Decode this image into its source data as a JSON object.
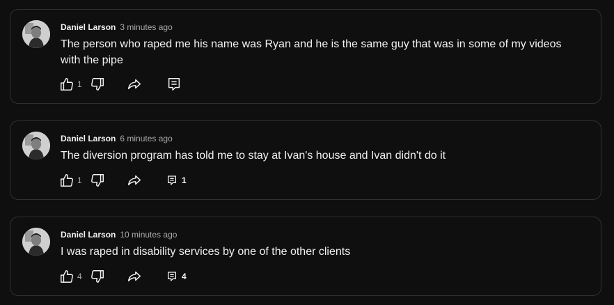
{
  "comments": [
    {
      "author": "Daniel Larson",
      "time": "3 minutes ago",
      "text": "The person who raped me his name was Ryan and he is the same guy that was in some of my videos with the pipe",
      "likes": "1",
      "replies": ""
    },
    {
      "author": "Daniel Larson",
      "time": "6 minutes ago",
      "text": "The diversion program has told me to stay at Ivan's house and Ivan didn't do it",
      "likes": "1",
      "replies": "1"
    },
    {
      "author": "Daniel Larson",
      "time": "10 minutes ago",
      "text": "I was raped in disability services by one of the other clients",
      "likes": "4",
      "replies": "4"
    }
  ],
  "icons": {
    "like": "thumbs-up-icon",
    "dislike": "thumbs-down-icon",
    "share": "share-arrow-icon",
    "reply": "reply-comment-icon"
  }
}
